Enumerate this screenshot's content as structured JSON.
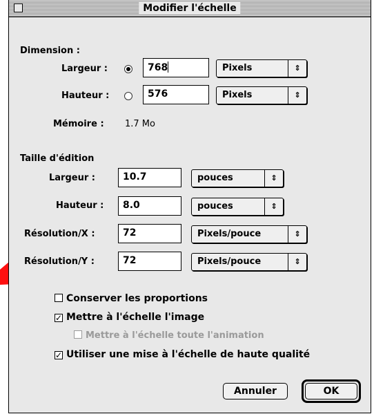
{
  "window": {
    "title": "Modifier l'échelle"
  },
  "dimension": {
    "heading": "Dimension :",
    "width_label": "Largeur :",
    "width_value": "768",
    "width_unit": "Pixels",
    "height_label": "Hauteur :",
    "height_value": "576",
    "height_unit": "Pixels",
    "selected_radio": "width",
    "memory_label": "Mémoire :",
    "memory_value": "1.7 Mo"
  },
  "print_size": {
    "heading": "Taille d'édition",
    "width_label": "Largeur :",
    "width_value": "10.7",
    "width_unit": "pouces",
    "height_label": "Hauteur :",
    "height_value": "8.0",
    "height_unit": "pouces",
    "res_x_label": "Résolution/X :",
    "res_x_value": "72",
    "res_x_unit": "Pixels/pouce",
    "res_y_label": "Résolution/Y :",
    "res_y_value": "72",
    "res_y_unit": "Pixels/pouce"
  },
  "options": {
    "keep_proportions": {
      "label": "Conserver les proportions",
      "checked": false
    },
    "scale_image": {
      "label": "Mettre à l'échelle l'image",
      "checked": true
    },
    "scale_animation": {
      "label": "Mettre à l'échelle toute l'animation",
      "checked": false,
      "enabled": false
    },
    "high_quality": {
      "label": "Utiliser une mise à l'échelle de haute qualité",
      "checked": true
    }
  },
  "buttons": {
    "cancel": "Annuler",
    "ok": "OK"
  },
  "colors": {
    "annotation_arrow": "#ff0000"
  }
}
